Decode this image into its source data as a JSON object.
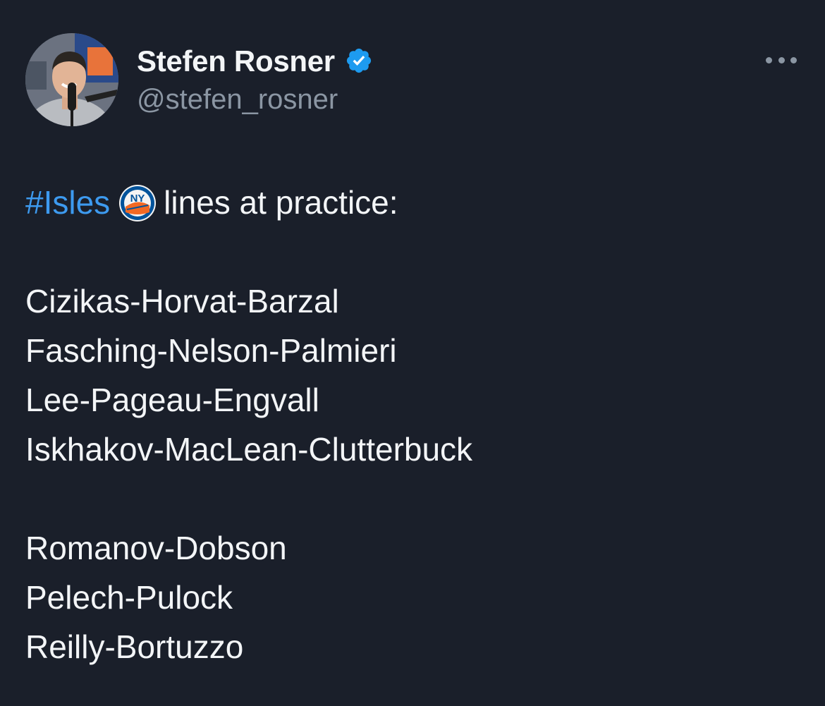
{
  "author": {
    "name": "Stefen Rosner",
    "handle": "@stefen_rosner",
    "verified": true,
    "verified_icon": "verified-badge-icon",
    "avatar_icon": "avatar"
  },
  "menu": {
    "icon": "more-options-icon"
  },
  "tweet": {
    "hashtag": "#Isles",
    "hashtag_icon": "new-york-islanders-logo-icon",
    "intro": "lines at practice:",
    "forward_lines": [
      "Cizikas-Horvat-Barzal",
      "Fasching-Nelson-Palmieri",
      "Lee-Pageau-Engvall",
      "Iskhakov-MacLean-Clutterbuck"
    ],
    "defense_pairs": [
      "Romanov-Dobson",
      "Pelech-Pulock",
      "Reilly-Bortuzzo"
    ]
  },
  "colors": {
    "background": "#1a1f2a",
    "text": "#f3f5f7",
    "secondary_text": "#8b96a3",
    "link": "#3d9aef",
    "verified": "#1d9bf0",
    "islanders_orange": "#f26924",
    "islanders_blue": "#00539b"
  }
}
